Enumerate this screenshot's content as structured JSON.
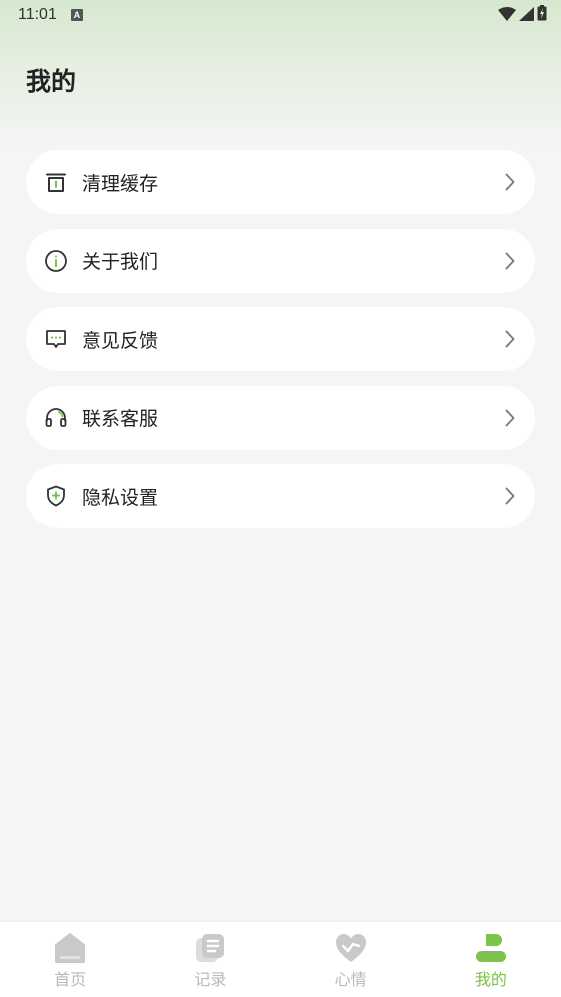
{
  "status_bar": {
    "time": "11:01",
    "notification_icon_letter": "A"
  },
  "header": {
    "title": "我的"
  },
  "menu": {
    "items": [
      {
        "label": "清理缓存",
        "icon": "trash-icon"
      },
      {
        "label": "关于我们",
        "icon": "info-icon"
      },
      {
        "label": "意见反馈",
        "icon": "feedback-icon"
      },
      {
        "label": "联系客服",
        "icon": "headset-icon"
      },
      {
        "label": "隐私设置",
        "icon": "shield-icon"
      }
    ]
  },
  "bottom_nav": {
    "items": [
      {
        "label": "首页",
        "icon": "home-icon",
        "active": false
      },
      {
        "label": "记录",
        "icon": "record-icon",
        "active": false
      },
      {
        "label": "心情",
        "icon": "heart-icon",
        "active": false
      },
      {
        "label": "我的",
        "icon": "profile-icon",
        "active": true
      }
    ]
  },
  "colors": {
    "accent": "#7dc24b",
    "inactive": "#c4c4c4",
    "text": "#222222",
    "background": "#f5f5f5"
  }
}
